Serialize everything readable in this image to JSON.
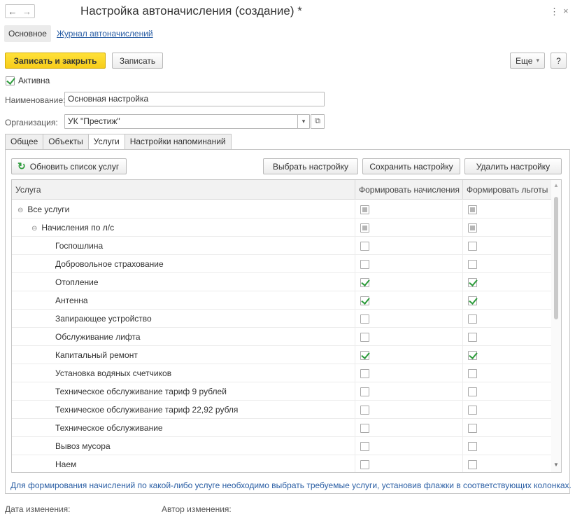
{
  "window": {
    "title": "Настройка автоначисления (создание) *",
    "back_icon": "←",
    "forward_icon": "→",
    "menu_icon": "⋮",
    "close_icon": "×"
  },
  "form_tabs": {
    "main": "Основное",
    "journal_link": "Журнал автоначислений"
  },
  "toolbar": {
    "save_close": "Записать и закрыть",
    "save": "Записать",
    "more": "Еще",
    "more_arrow": "▾",
    "help": "?"
  },
  "active": {
    "label": "Активна",
    "checked": true
  },
  "name_field": {
    "label": "Наименование:",
    "value": "Основная настройка"
  },
  "org_field": {
    "label": "Организация:",
    "value": "УК \"Престиж\"",
    "dropdown": "▾",
    "open": "⧉"
  },
  "tabs": [
    "Общее",
    "Объекты",
    "Услуги",
    "Настройки напоминаний"
  ],
  "services_toolbar": {
    "refresh_icon": "↻",
    "refresh": "Обновить список услуг",
    "choose": "Выбрать настройку",
    "save_setting": "Сохранить настройку",
    "delete_setting": "Удалить настройку"
  },
  "grid": {
    "columns": [
      "Услуга",
      "Формировать начисления",
      "Формировать льготы"
    ],
    "rows": [
      {
        "name": "Все услуги",
        "level": 0,
        "group": true,
        "accrual": "partial",
        "benefit": "partial"
      },
      {
        "name": "Начисления по л/с",
        "level": 1,
        "group": true,
        "accrual": "partial",
        "benefit": "partial"
      },
      {
        "name": "Госпошлина",
        "level": 2,
        "accrual": "off",
        "benefit": "off"
      },
      {
        "name": "Добровольное страхование",
        "level": 2,
        "accrual": "off",
        "benefit": "off"
      },
      {
        "name": "Отопление",
        "level": 2,
        "accrual": "on",
        "benefit": "on"
      },
      {
        "name": "Антенна",
        "level": 2,
        "accrual": "on",
        "benefit": "on"
      },
      {
        "name": "Запирающее устройство",
        "level": 2,
        "accrual": "off",
        "benefit": "off"
      },
      {
        "name": "Обслуживание лифта",
        "level": 2,
        "accrual": "off",
        "benefit": "off"
      },
      {
        "name": "Капитальный ремонт",
        "level": 2,
        "accrual": "on",
        "benefit": "on"
      },
      {
        "name": "Установка водяных счетчиков",
        "level": 2,
        "accrual": "off",
        "benefit": "off"
      },
      {
        "name": "Техническое обслуживание тариф 9 рублей",
        "level": 2,
        "accrual": "off",
        "benefit": "off"
      },
      {
        "name": "Техническое обслуживание тариф 22,92 рубля",
        "level": 2,
        "accrual": "off",
        "benefit": "off"
      },
      {
        "name": "Техническое обслуживание",
        "level": 2,
        "accrual": "off",
        "benefit": "off"
      },
      {
        "name": "Вывоз мусора",
        "level": 2,
        "accrual": "off",
        "benefit": "off"
      },
      {
        "name": "Наем",
        "level": 2,
        "accrual": "off",
        "benefit": "off"
      }
    ],
    "collapse_icon": "⊖",
    "scroll_up": "▲",
    "scroll_down": "▼"
  },
  "hint": "Для формирования начислений по какой-либо услуге необходимо выбрать требуемые услуги, установив флажки в соответствующих колонках.",
  "footer": {
    "changed_date": "Дата изменения:",
    "changed_author": "Автор изменения:"
  }
}
